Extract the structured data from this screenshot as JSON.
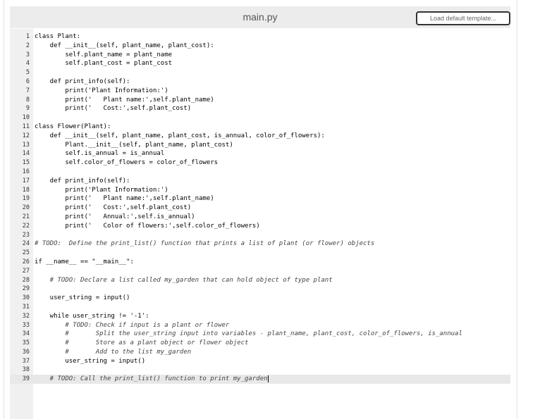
{
  "header": {
    "filename": "main.py",
    "load_button": "Load default template..."
  },
  "editor": {
    "active_line": 39,
    "lines": [
      "class Plant:",
      "    def __init__(self, plant_name, plant_cost):",
      "        self.plant_name = plant_name",
      "        self.plant_cost = plant_cost",
      "",
      "    def print_info(self):",
      "        print('Plant Information:')",
      "        print('   Plant name:',self.plant_name)",
      "        print('   Cost:',self.plant_cost)",
      "",
      "class Flower(Plant):",
      "    def __init__(self, plant_name, plant_cost, is_annual, color_of_flowers):",
      "        Plant.__init__(self, plant_name, plant_cost)",
      "        self.is_annual = is_annual",
      "        self.color_of_flowers = color_of_flowers",
      "",
      "    def print_info(self):",
      "        print('Plant Information:')",
      "        print('   Plant name:',self.plant_name)",
      "        print('   Cost:',self.plant_cost)",
      "        print('   Annual:',self.is_annual)",
      "        print('   Color of flowers:',self.color_of_flowers)",
      "",
      "# TODO:  Define the print_list() function that prints a list of plant (or flower) objects",
      "",
      "if __name__ == \"__main__\":",
      "",
      "    # TODO: Declare a list called my_garden that can hold object of type plant",
      "",
      "    user_string = input()",
      "",
      "    while user_string != '-1':",
      "        # TODO: Check if input is a plant or flower",
      "        #       Split the user_string input into variables - plant_name, plant_cost, color_of_flowers, is_annual",
      "        #       Store as a plant object or flower object",
      "        #       Add to the list my_garden",
      "        user_string = input()",
      "",
      "    # TODO: Call the print_list() function to print my_garden"
    ]
  }
}
